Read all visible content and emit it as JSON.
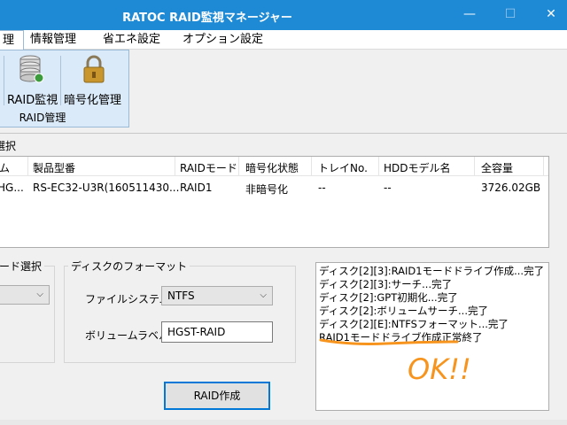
{
  "window": {
    "title": "RATOC RAID監視マネージャー",
    "minimize": "—",
    "maximize": "☐",
    "close": "✕"
  },
  "menu": {
    "items": [
      {
        "label": "理",
        "active": true
      },
      {
        "label": "情報管理"
      },
      {
        "label": "省エネ設定"
      },
      {
        "label": "オプション設定"
      }
    ]
  },
  "ribbon": {
    "buttons": [
      {
        "label": "RAID監視",
        "icon": "disk-stack-icon"
      },
      {
        "label": "暗号化管理",
        "icon": "padlock-icon"
      }
    ],
    "group_label": "RAID管理"
  },
  "disk_section": {
    "label": "選択",
    "columns": [
      "ム",
      "製品型番",
      "RAIDモード",
      "暗号化状態",
      "トレイNo.",
      "HDDモデル名",
      "全容量"
    ],
    "rows": [
      [
        "HG...",
        "RS-EC32-U3R(160511430...",
        "RAID1",
        "非暗号化",
        "--",
        "--",
        "3726.02GB"
      ]
    ]
  },
  "mode_select": {
    "legend": "ード選択"
  },
  "format": {
    "legend": "ディスクのフォーマット",
    "fs_label": "ファイルシステム",
    "fs_value": "NTFS",
    "volume_label": "ボリュームラベル",
    "volume_value": "HGST-RAID"
  },
  "create_button": "RAID作成",
  "log": {
    "lines": [
      "ディスク[2][3]:RAID1モードドライブ作成...完了",
      "ディスク[2][3]:サーチ...完了",
      "ディスク[2]:GPT初期化...完了",
      "ディスク[2]:ボリュームサーチ...完了",
      "ディスク[2][E]:NTFSフォーマット...完了",
      "RAID1モードドライブ作成正常終了"
    ],
    "annotation": "OK!!"
  },
  "colors": {
    "title_bar": "#1e8ad6",
    "ribbon_bg": "#dbeaf8",
    "annotation": "#f7941d",
    "focus_border": "#0078d7"
  }
}
